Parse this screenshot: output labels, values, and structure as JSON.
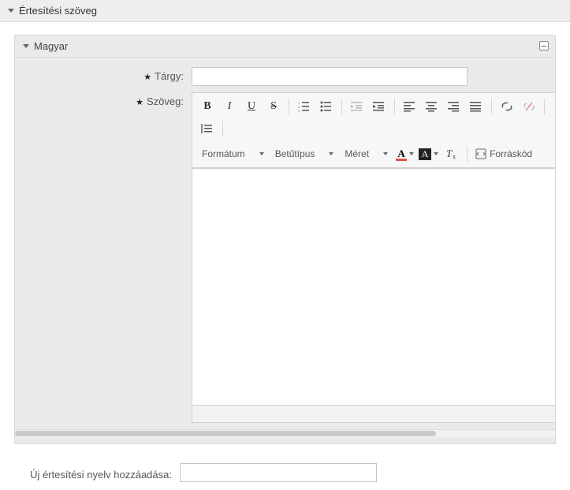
{
  "section": {
    "title": "Értesítési szöveg"
  },
  "panel": {
    "title": "Magyar"
  },
  "form": {
    "subject_label": "Tárgy:",
    "body_label": "Szöveg:",
    "subject_value": ""
  },
  "toolbar": {
    "bold": "B",
    "italic": "I",
    "underline": "U",
    "strike": "S",
    "format_label": "Formátum",
    "font_label": "Betűtípus",
    "size_label": "Méret",
    "textcolor_glyph": "A",
    "bgcolor_glyph": "A",
    "source_label": "Forráskód"
  },
  "footer": {
    "add_lang_label": "Új értesítési nyelv hozzáadása:",
    "add_lang_value": ""
  }
}
